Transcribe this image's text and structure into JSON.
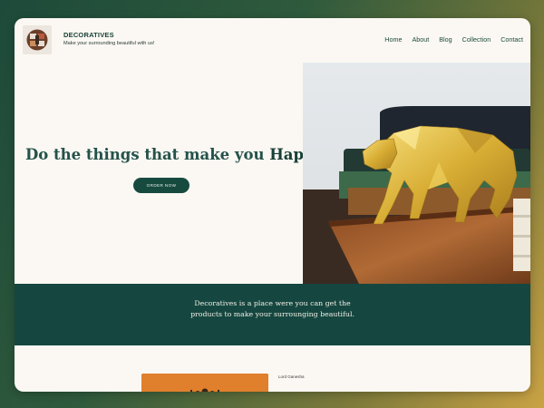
{
  "brand": {
    "name": "DECORATIVES",
    "tagline": "Make your surrounding beautiful with us!"
  },
  "nav": [
    "Home",
    "About",
    "Blog",
    "Collection",
    "Contact"
  ],
  "hero": {
    "title_prefix": "Do the things that make you ",
    "title_highlight": "Happy",
    "title_suffix": ".",
    "button_label": "ORDER NOW"
  },
  "band": {
    "line1": "Decoratives is a place were you can get the",
    "line2": "products to make your surrounging beautiful."
  },
  "product": {
    "label": "Lord Ganesha"
  },
  "colors": {
    "brand_green": "#154740",
    "cream": "#fbf8f3",
    "gold": "#d7b24a",
    "orange": "#e07f2c"
  }
}
